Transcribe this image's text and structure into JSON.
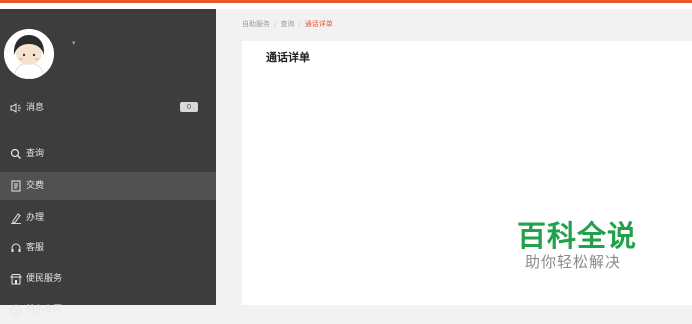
{
  "profile": {
    "caret": "▾"
  },
  "nav": {
    "items": [
      {
        "label": "消息",
        "badge": "0"
      },
      {
        "label": "查询"
      },
      {
        "label": "交费"
      },
      {
        "label": "办理"
      },
      {
        "label": "客服"
      },
      {
        "label": "便民服务"
      },
      {
        "label": "特色专区"
      }
    ],
    "active_index": 2
  },
  "breadcrumb": {
    "items": [
      "自助服务",
      "查询",
      "通话详单"
    ],
    "separator": "/"
  },
  "panel": {
    "title": "通话详单"
  },
  "watermark": {
    "main": "百科全说",
    "sub": "助你轻松解决"
  },
  "colors": {
    "accent": "#e8582b",
    "sidebar": "#3d3d3d",
    "sidebar_active": "#515151",
    "watermark": "#22a04b"
  },
  "icons": [
    "speaker-icon",
    "search-icon",
    "bill-icon",
    "pen-icon",
    "headset-icon",
    "store-icon",
    "clock-icon"
  ]
}
